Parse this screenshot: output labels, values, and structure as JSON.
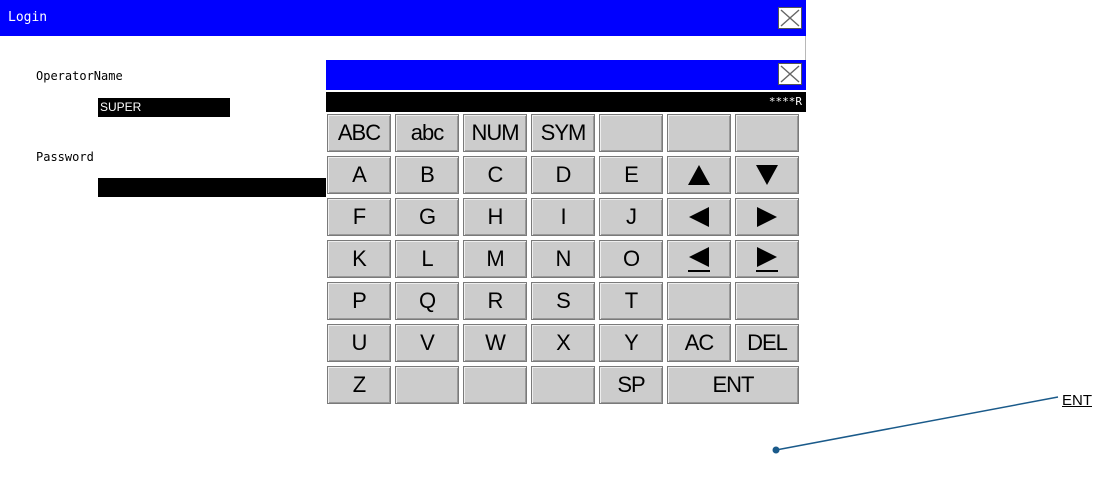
{
  "window": {
    "title": "Login",
    "operator_label": "OperatorName",
    "operator_value": "SUPER",
    "password_label": "Password",
    "password_value": ""
  },
  "keyboard": {
    "display_text": "****R",
    "keys": [
      {
        "label": "ABC",
        "name": "key-abc-mode"
      },
      {
        "label": "abc",
        "name": "key-lowercase-mode"
      },
      {
        "label": "NUM",
        "name": "key-num-mode"
      },
      {
        "label": "SYM",
        "name": "key-sym-mode"
      },
      {
        "label": "",
        "name": "key-blank"
      },
      {
        "label": "",
        "name": "key-blank"
      },
      {
        "label": "",
        "name": "key-blank"
      },
      {
        "label": "A",
        "name": "key-a"
      },
      {
        "label": "B",
        "name": "key-b"
      },
      {
        "label": "C",
        "name": "key-c"
      },
      {
        "label": "D",
        "name": "key-d"
      },
      {
        "label": "E",
        "name": "key-e"
      },
      {
        "icon": "up-arrow-icon",
        "name": "key-up-arrow"
      },
      {
        "icon": "down-arrow-icon",
        "name": "key-down-arrow"
      },
      {
        "label": "F",
        "name": "key-f"
      },
      {
        "label": "G",
        "name": "key-g"
      },
      {
        "label": "H",
        "name": "key-h"
      },
      {
        "label": "I",
        "name": "key-i"
      },
      {
        "label": "J",
        "name": "key-j"
      },
      {
        "icon": "left-arrow-icon",
        "name": "key-left-arrow"
      },
      {
        "icon": "right-arrow-icon",
        "name": "key-right-arrow"
      },
      {
        "label": "K",
        "name": "key-k"
      },
      {
        "label": "L",
        "name": "key-l"
      },
      {
        "label": "M",
        "name": "key-m"
      },
      {
        "label": "N",
        "name": "key-n"
      },
      {
        "label": "O",
        "name": "key-o"
      },
      {
        "icon": "cursor-home-icon",
        "name": "key-cursor-home"
      },
      {
        "icon": "cursor-end-icon",
        "name": "key-cursor-end"
      },
      {
        "label": "P",
        "name": "key-p"
      },
      {
        "label": "Q",
        "name": "key-q"
      },
      {
        "label": "R",
        "name": "key-r"
      },
      {
        "label": "S",
        "name": "key-s"
      },
      {
        "label": "T",
        "name": "key-t"
      },
      {
        "label": "",
        "name": "key-blank"
      },
      {
        "label": "",
        "name": "key-blank"
      },
      {
        "label": "U",
        "name": "key-u"
      },
      {
        "label": "V",
        "name": "key-v"
      },
      {
        "label": "W",
        "name": "key-w"
      },
      {
        "label": "X",
        "name": "key-x"
      },
      {
        "label": "Y",
        "name": "key-y"
      },
      {
        "label": "AC",
        "name": "key-all-clear"
      },
      {
        "label": "DEL",
        "name": "key-delete"
      },
      {
        "label": "Z",
        "name": "key-z"
      },
      {
        "label": "",
        "name": "key-blank"
      },
      {
        "label": "",
        "name": "key-blank"
      },
      {
        "label": "",
        "name": "key-blank"
      },
      {
        "label": "SP",
        "name": "key-space"
      },
      {
        "label": "ENT",
        "name": "key-enter",
        "wide": true
      }
    ]
  },
  "callout": {
    "label": "ENT"
  },
  "colors": {
    "titlebar": "#0000ff",
    "key_face": "#cccccc",
    "callout_line": "#1a5a8a"
  }
}
